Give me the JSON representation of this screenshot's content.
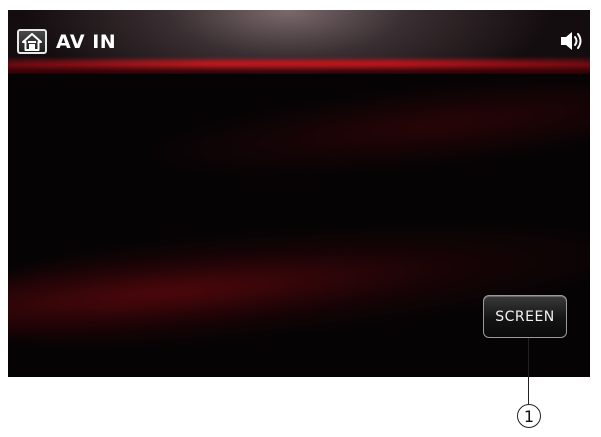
{
  "header": {
    "title": "AV IN",
    "home_icon": "home-icon",
    "volume_icon": "speaker-volume-icon"
  },
  "main": {
    "screen_button_label": "SCREEN"
  },
  "annotation": {
    "callout_number": "1"
  },
  "colors": {
    "background": "#050304",
    "accent_red": "#c8141c",
    "text": "#ffffff"
  }
}
